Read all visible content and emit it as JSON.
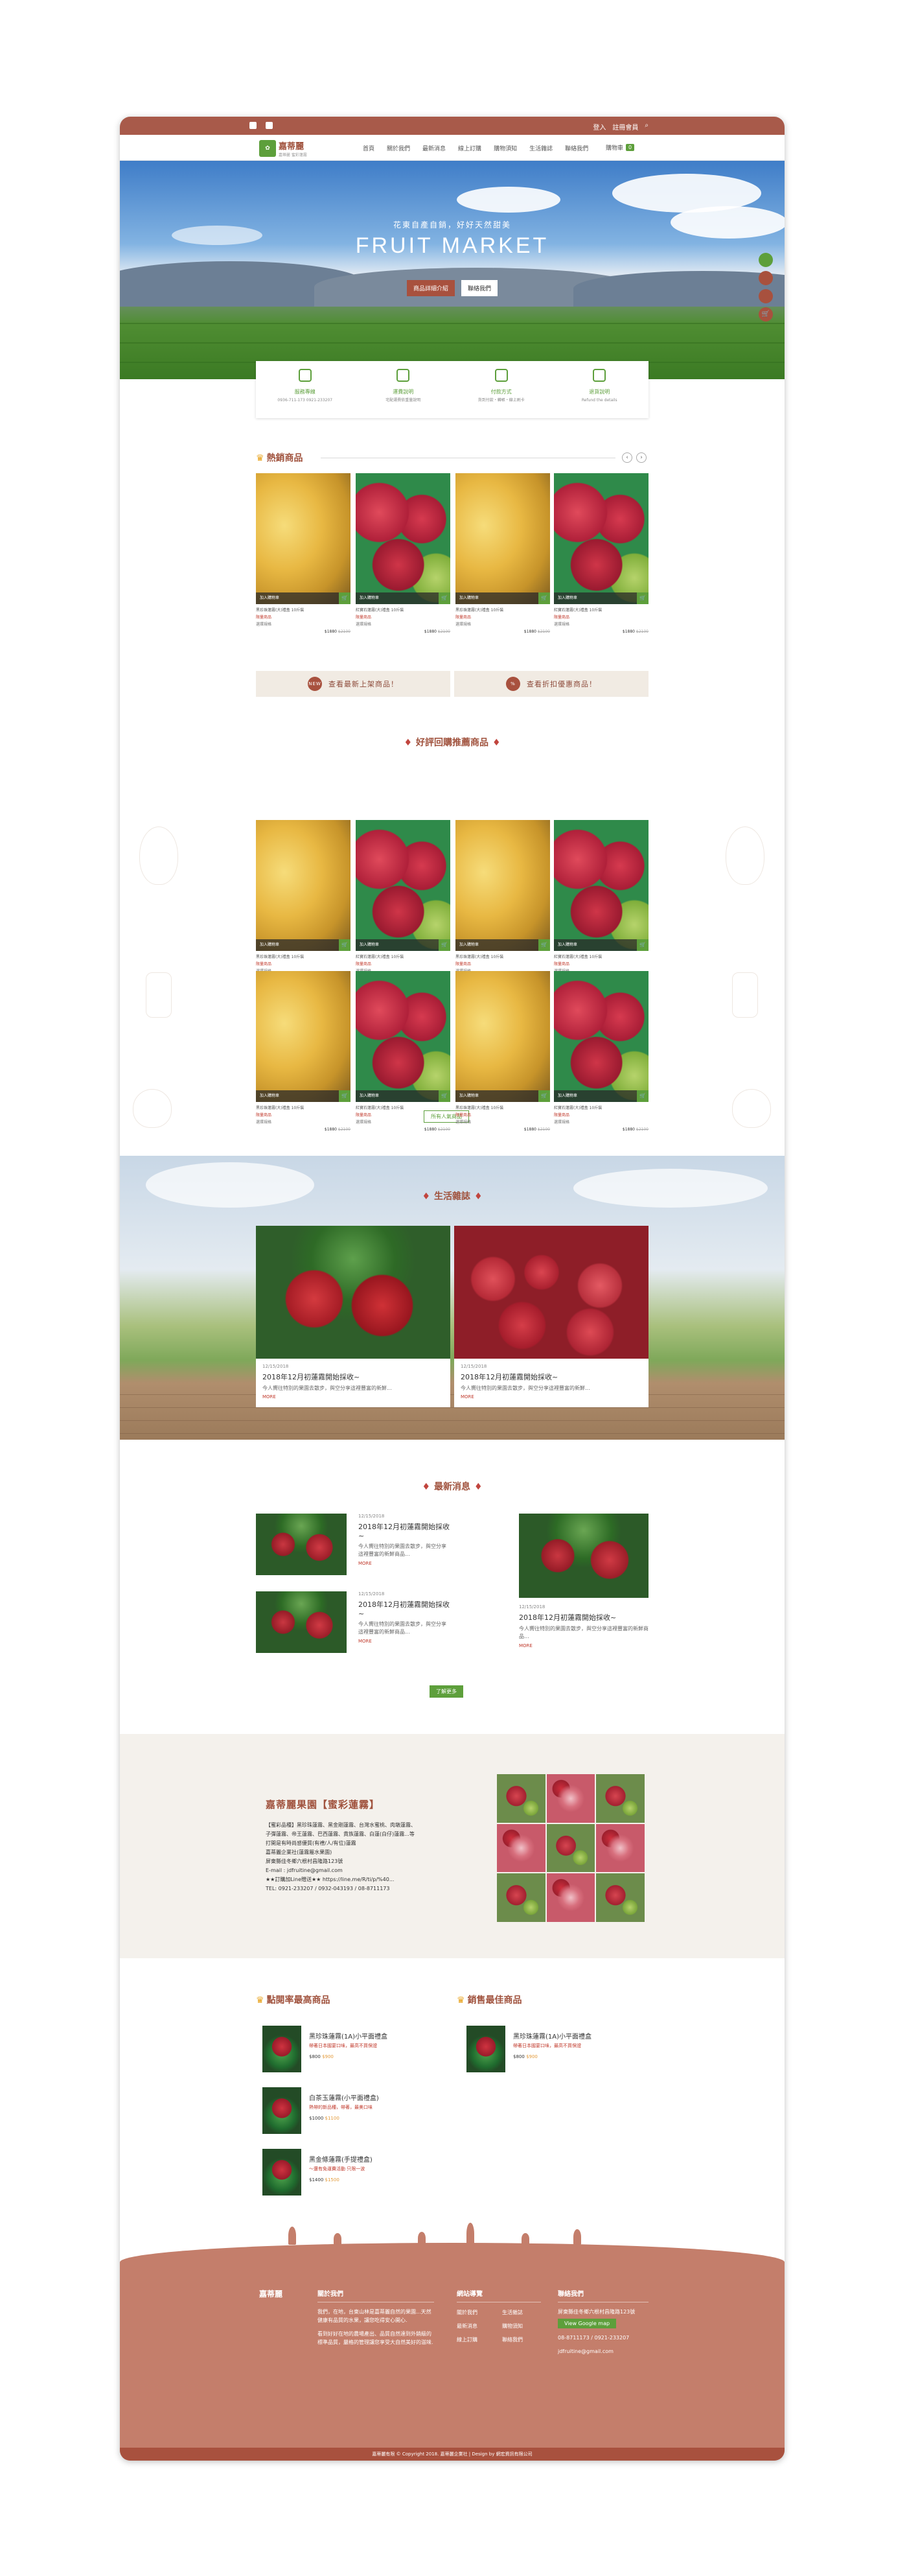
{
  "topbar": {
    "login": "登入",
    "register": "註冊會員",
    "search_icon": "search-icon"
  },
  "nav": {
    "brand": "嘉蒂麗",
    "brand_sub": "嘉蒂麗 蜜彩蓮霧",
    "items": [
      "首頁",
      "關於我們",
      "最新消息",
      "線上訂購",
      "購物須知",
      "生活雜誌",
      "聯絡我們"
    ],
    "cart_label": "購物車",
    "cart_count": "0"
  },
  "hero": {
    "subtitle": "花東自產自銷，好好天然甜美",
    "title": "FRUIT MARKET",
    "btn1": "商品詳細介紹",
    "btn2": "聯絡我們"
  },
  "features": [
    {
      "title": "服務專線",
      "desc": "0936-711-173\n0921-233207"
    },
    {
      "title": "運費說明",
      "desc": "宅配運費依重量說明"
    },
    {
      "title": "付款方式",
      "desc": "貨到付款・轉帳・線上刷卡"
    },
    {
      "title": "退貨說明",
      "desc": "Refund the details"
    }
  ],
  "hot": {
    "title": "熱銷商品"
  },
  "products": [
    {
      "name": "黑珍珠蓮霧(大)禮盒 10斤裝",
      "tag": "限量商品",
      "opt": "選擇規格",
      "price": "$1880",
      "old": "$2100",
      "bar": "加入購物車"
    },
    {
      "name": "紅寶石蓮霧(大)禮盒 10斤裝",
      "tag": "限量商品",
      "opt": "選擇規格",
      "price": "$1880",
      "old": "$2100",
      "bar": "加入購物車"
    },
    {
      "name": "黑珍珠蓮霧(大)禮盒 10斤裝",
      "tag": "限量商品",
      "opt": "選擇規格",
      "price": "$1880",
      "old": "$2100",
      "bar": "加入購物車"
    },
    {
      "name": "紅寶石蓮霧(大)禮盒 10斤裝",
      "tag": "限量商品",
      "opt": "選擇規格",
      "price": "$1880",
      "old": "$2100",
      "bar": "加入購物車"
    }
  ],
  "promo": {
    "new": "查看最新上架商品！",
    "new_badge": "NEW",
    "sale": "查看折扣優惠商品！"
  },
  "recommend": {
    "title": "好評回購推薦商品",
    "more": "所有人氣商品"
  },
  "magazine": {
    "title": "生活雜誌",
    "cards": [
      {
        "date": "12/15/2018",
        "title": "2018年12月初蓮霧開始採收~",
        "text": "今人嚮往特別的果園去散步，與空分享這裡豐富的新鮮...",
        "more": "MORE"
      },
      {
        "date": "12/15/2018",
        "title": "2018年12月初蓮霧開始採收~",
        "text": "今人嚮往特別的果園去散步，與空分享這裡豐富的新鮮...",
        "more": "MORE"
      }
    ]
  },
  "latest": {
    "title": "最新消息",
    "items": [
      {
        "date": "12/15/2018",
        "title": "2018年12月初蓮霧開始採收~",
        "text": "今人嚮往特別的果園去散步，與空分享這裡豐富的新鮮商品...",
        "more": "MORE"
      },
      {
        "date": "12/15/2018",
        "title": "2018年12月初蓮霧開始採收~",
        "text": "今人嚮往特別的果園去散步，與空分享這裡豐富的新鮮商品...",
        "more": "MORE"
      },
      {
        "date": "12/15/2018",
        "title": "2018年12月初蓮霧開始採收~",
        "text": "今人嚮往特別的果園去散步，與空分享這裡豐富的新鮮商品...",
        "more": "MORE"
      }
    ],
    "more": "了解更多"
  },
  "about": {
    "title": "嘉蒂麗果園【蜜彩蓮霧】",
    "lines": [
      "【蜜彩品種】黑珍珠蓮霧、黑金剛蓮霧、台灣水蜜桃、肉墩蓮霧、",
      "子彈蓮霧、帝王蓮霧、巴西蓮霧、貴族蓮霧、白蓮(白仔)蓮霧...等",
      "打開是有時尚感優質(有禮/人/有位)蓮霧",
      "嘉蒂麗企業社(蓮霧屬水果園)",
      "屏東縣佳冬鄉六根村昌隆路123號",
      "E-mail : jdfruitine@gmail.com",
      "★★訂購加Line贈送★★ https://line.me/R/ti/p/%40...",
      "TEL: 0921-233207 / 0932-043193 / 08-8711173"
    ]
  },
  "mostclicked": {
    "title": "點閱率最高商品",
    "items": [
      {
        "name": "黑珍珠蓮霧(1A)小平面禮盒",
        "tag": "帶著日本國宴口味，最高不買保證",
        "price": "$800",
        "old": "$900"
      },
      {
        "name": "白茶玉蓮霧(小平面禮盒)",
        "tag": "熱帶的新品種，帶著，最美口味",
        "price": "$1000",
        "old": "$1100"
      },
      {
        "name": "黑金條蓮霧(手提禮盒)",
        "tag": "～還有免運費活動 只限一波",
        "price": "$1400",
        "old": "$1500"
      }
    ]
  },
  "bestsell": {
    "title": "銷售最佳商品",
    "items": [
      {
        "name": "黑珍珠蓮霧(1A)小平面禮盒",
        "tag": "帶著日本國宴口味，最高不買保證",
        "price": "$800",
        "old": "$900"
      }
    ]
  },
  "footer": {
    "about_h": "關於我們",
    "about_t": "我們，在地，台東山林是嘉蒂麗自然的果園...天然健康有品質的水果，讓您吃得安心開心.",
    "about_t2": "看到好好在地的農場產出、品質自然達到外銷級的標準品質，嚴格的管理讓您享受大自然美好的滋味.",
    "links_h": "網站導覽",
    "links": [
      "關於我們",
      "最新消息",
      "線上訂購",
      "生活雜誌",
      "購物須知",
      "聯絡我們"
    ],
    "contact_h": "聯絡我們",
    "addr": "屏東縣佳冬鄉六根村昌隆路123號",
    "map": "View Google map",
    "tel": "08-8711173 / 0921-233207",
    "mail": "jdfruitine@gmail.com",
    "copyright": "嘉蒂麗有限 © Copyright 2018. 嘉蒂麗企業社 | Design by 網宏資訊有限公司"
  }
}
